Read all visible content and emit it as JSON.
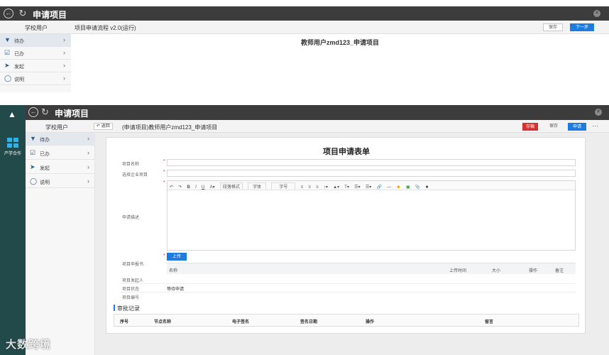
{
  "top": {
    "title": "申请项目",
    "user": "学校用户",
    "process": "项目申请流程 v2.0(运行)",
    "center_title": "教师用户zmd123_申请项目",
    "buttons": {
      "save": "保存",
      "next": "下一步"
    },
    "sidebar": [
      {
        "label": "待办",
        "icon": "inbox-icon"
      },
      {
        "label": "已办",
        "icon": "check-box-icon"
      },
      {
        "label": "发起",
        "icon": "send-icon"
      },
      {
        "label": "说明",
        "icon": "lightbulb-icon"
      }
    ]
  },
  "bottom": {
    "title": "申请项目",
    "user": "学校用户",
    "back": "返回",
    "breadcrumb": "(申请项目)教师用户zmd123_申请项目",
    "buttons": {
      "save_draft": "存稿",
      "save": "保存",
      "submit": "申请",
      "more": "···"
    },
    "rail_label": "产学合作",
    "sidebar": [
      {
        "label": "待办"
      },
      {
        "label": "已办"
      },
      {
        "label": "发起"
      },
      {
        "label": "说明"
      }
    ],
    "form": {
      "title": "项目申请表单",
      "fields": {
        "project_name": "项目名称",
        "company_project": "选择企业项目",
        "description": "申请描述",
        "report": "项目申报书",
        "initiator": "项目发起人",
        "status_label": "项目状态",
        "status_value": "等待申请",
        "number": "项目编号"
      },
      "editor_toolbar": {
        "format": "段落格式",
        "font": "字体",
        "size": "字号"
      },
      "upload": {
        "button": "上传",
        "columns": [
          "名称",
          "上传时间",
          "大小",
          "操作",
          "备注"
        ]
      },
      "approval": {
        "title": "审批记录",
        "columns": [
          "序号",
          "节点名称",
          "电子签名",
          "签名日期",
          "操作",
          "留言"
        ]
      }
    }
  },
  "watermark": "大数跨境"
}
